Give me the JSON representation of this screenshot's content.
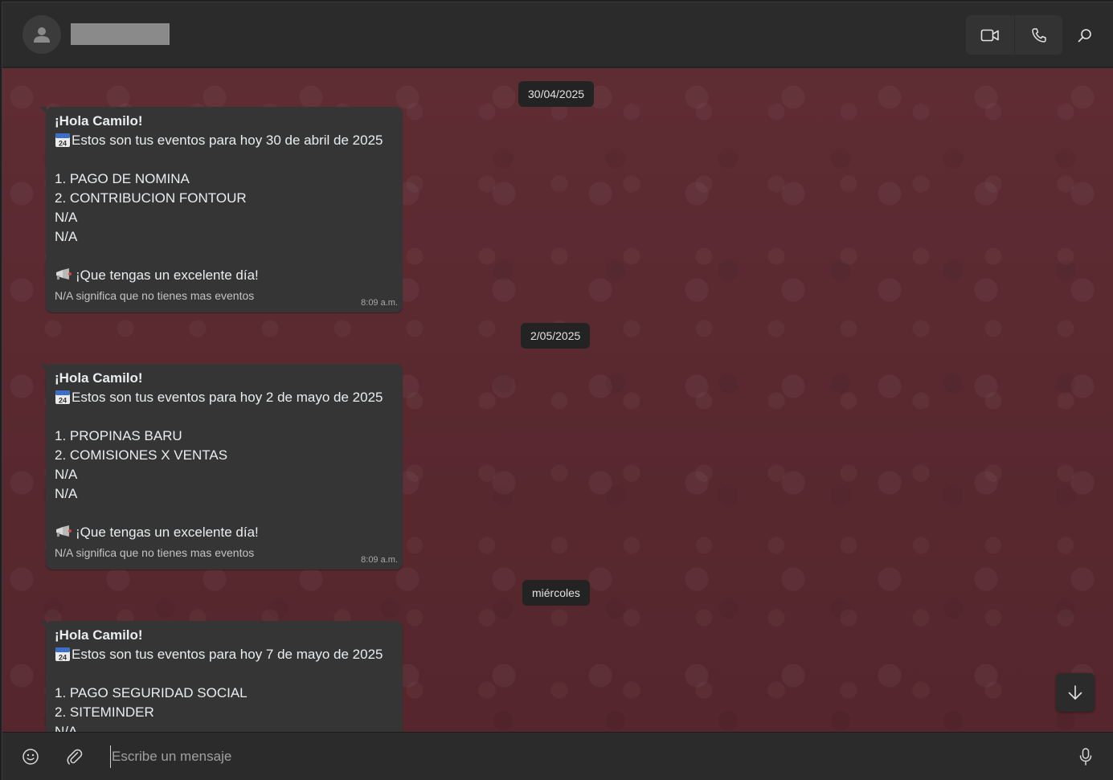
{
  "header": {
    "contact_name": "",
    "icons": {
      "avatar": "person-icon",
      "video": "video-camera-icon",
      "call": "phone-icon",
      "search": "search-icon"
    }
  },
  "chat": {
    "date_chips": [
      "30/04/2025",
      "2/05/2025",
      "miércoles"
    ],
    "messages": [
      {
        "greeting": "¡Hola Camilo!",
        "intro": "Estos son tus eventos para hoy 30 de abril de 2025",
        "events": [
          "1. PAGO DE NOMINA",
          "2. CONTRIBUCION FONTOUR",
          "N/A",
          "N/A"
        ],
        "closing": "¡Que tengas un excelente día!",
        "note": "N/A significa que no tienes mas eventos",
        "time": "8:09 a.m."
      },
      {
        "greeting": "¡Hola Camilo!",
        "intro": "Estos son tus eventos para hoy 2 de mayo de 2025",
        "events": [
          "1. PROPINAS BARU",
          "2. COMISIONES X VENTAS",
          "N/A",
          "N/A"
        ],
        "closing": "¡Que tengas un excelente día!",
        "note": "N/A significa que no tienes mas eventos",
        "time": "8:09 a.m."
      },
      {
        "greeting": "¡Hola Camilo!",
        "intro": "Estos son tus eventos para hoy 7 de mayo de 2025",
        "events": [
          "1. PAGO SEGURIDAD SOCIAL",
          "2. SITEMINDER",
          "N/A"
        ]
      }
    ],
    "emoji": {
      "calendar": "calendar-24-emoji",
      "horn": "megaphone-emoji"
    }
  },
  "composer": {
    "placeholder": "Escribe un mensaje",
    "value": "",
    "icons": {
      "emoji": "smiley-icon",
      "attach": "paperclip-icon",
      "mic": "microphone-icon"
    }
  },
  "colors": {
    "chat_background": "#5a2a31",
    "bubble": "#353535",
    "chrome": "#2b2b2b",
    "chip": "#232323"
  }
}
